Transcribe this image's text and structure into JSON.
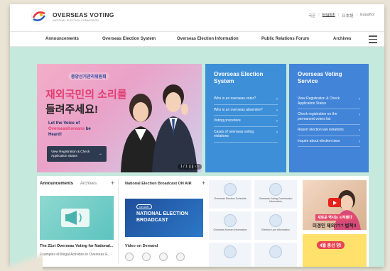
{
  "header": {
    "logo_title": "OVERSEAS VOTING",
    "logo_subtitle": "NATIONAL ELECTION COMMISSION",
    "languages": [
      "국문",
      "English",
      "日本語",
      "Español"
    ]
  },
  "nav": {
    "items": [
      "Announcements",
      "Overseas Election System",
      "Overseas Election Information",
      "Public Relations Forum",
      "Archives"
    ]
  },
  "banner": {
    "small_label": "중앙선거관리위원회",
    "headline_1": "재외국민의 소리를",
    "headline_2": "들려주세요!",
    "tagline_1": "Let the Voice of",
    "tagline_2": "OverseasKoreans",
    "tagline_3": " be Heard!",
    "button_label": "View Registration & Check Application Status",
    "pager": "1 / 1  ❙❙ ‹ ›"
  },
  "panels": [
    {
      "title": "Overseas Election System",
      "links": [
        "Who is an overseas voter?",
        "Who is an overseas absentee?",
        "Voting procedure",
        "Cases of overseas voting violations"
      ]
    },
    {
      "title": "Overseas Voting Service",
      "links": [
        "View Registration & Check Application Status",
        "Check registration on the permanent voters list",
        "Report election law violations",
        "Inquire about election laws"
      ]
    }
  ],
  "lower": {
    "tab_announcements": "Announcements",
    "tab_archives": "Archives",
    "plus": "+",
    "ann_title": "The 21st Overseas Voting for National...",
    "ann_sub": "Examples of Illegal Activities in Overseas E...",
    "broadcast_label": "National Election Broadcast ON AIR",
    "broadcast_onair": "ON AIR",
    "broadcast_text_1": "NATIONAL ELECTION",
    "broadcast_text_2": "BROADCAST",
    "vod_label": "Video on Demand"
  },
  "grid": [
    "Overseas Election Schedule",
    "Overseas Voting Commission Information",
    "Overseas Korean Information",
    "Election Law Information"
  ],
  "videos": {
    "v1_caption1": "새로운 역사는 시작됐다",
    "v1_caption2": "미경민 제외??? 법적!!",
    "v2_caption": "4월 총선 양!"
  }
}
